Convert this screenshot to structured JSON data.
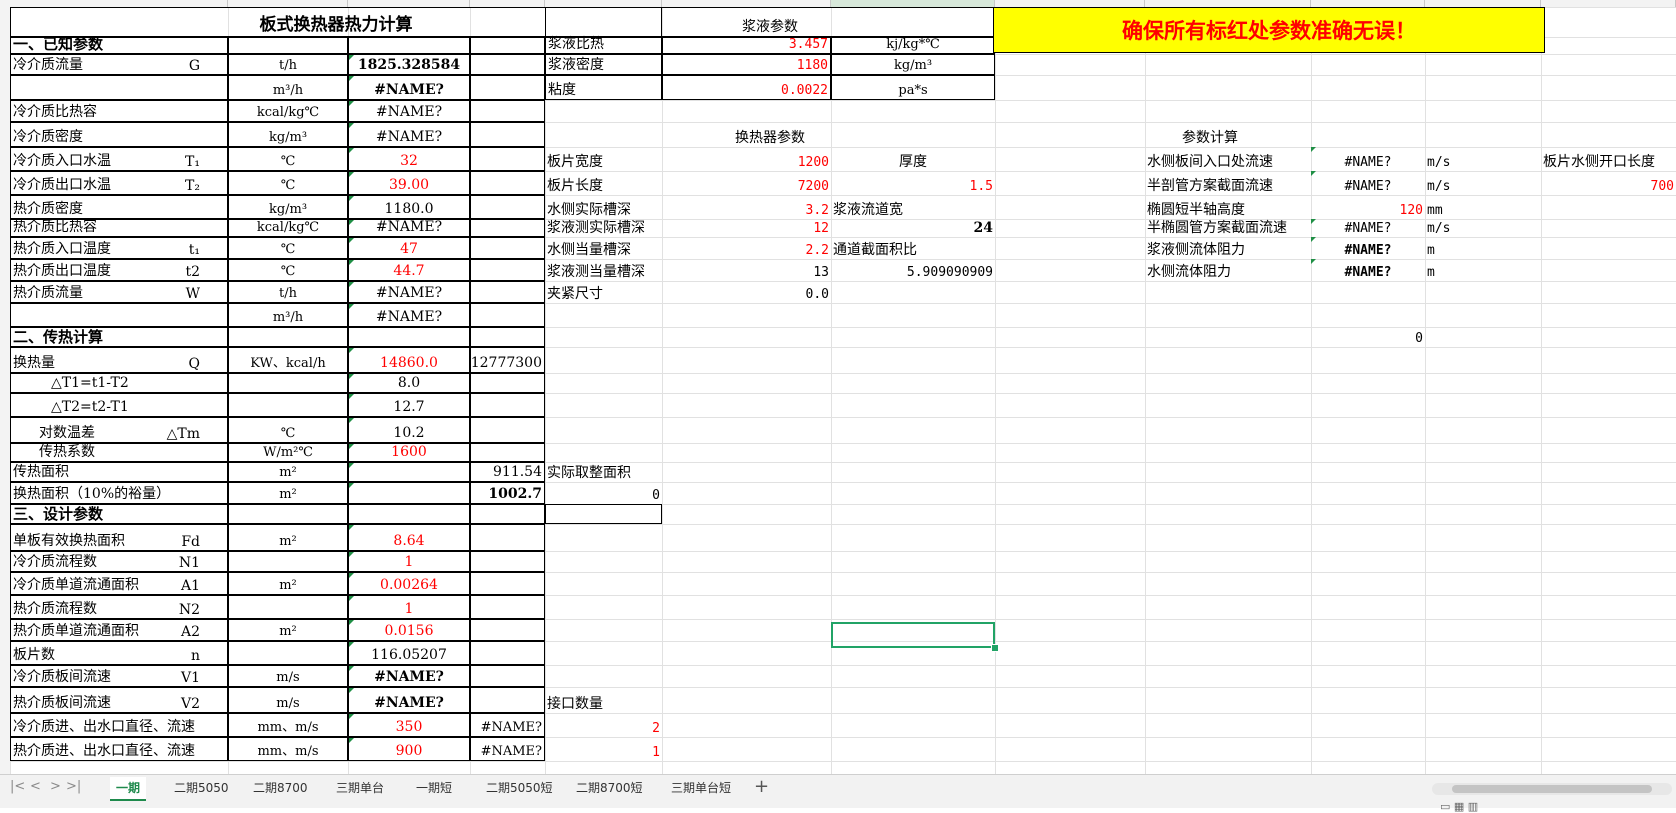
{
  "banner": "确保所有标红处参数准确无误！",
  "title": "板式换热器热力计算",
  "sec1": "一、已知参数",
  "sec2": "二、传热计算",
  "sec3": "三、设计参数",
  "rows": [
    {
      "name": "冷介质流量",
      "sym": "G",
      "unit": "t/h",
      "val": "1825.328584"
    },
    {
      "name": "",
      "sym": "",
      "unit": "m³/h",
      "val": "#NAME?"
    },
    {
      "name": "冷介质比热容",
      "sym": "",
      "unit": "kcal/kg℃",
      "val": "#NAME?"
    },
    {
      "name": "冷介质密度",
      "sym": "",
      "unit": "kg/m³",
      "val": "#NAME?"
    },
    {
      "name": "冷介质入口水温",
      "sym": "T₁",
      "unit": "℃",
      "val": "32"
    },
    {
      "name": "冷介质出口水温",
      "sym": "T₂",
      "unit": "℃",
      "val": "39.00"
    },
    {
      "name": "热介质密度",
      "sym": "",
      "unit": "kg/m³",
      "val": "1180.0"
    },
    {
      "name": "热介质比热容",
      "sym": "",
      "unit": "kcal/kg℃",
      "val": "#NAME?"
    },
    {
      "name": "热介质入口温度",
      "sym": "t₁",
      "unit": "℃",
      "val": "47"
    },
    {
      "name": "热介质出口温度",
      "sym": "t2",
      "unit": "℃",
      "val": "44.7"
    },
    {
      "name": "热介质流量",
      "sym": "W",
      "unit": "t/h",
      "val": "#NAME?"
    },
    {
      "name": "",
      "sym": "",
      "unit": "m³/h",
      "val": "#NAME?"
    },
    {
      "name": "换热量",
      "sym": "Q",
      "unit": "KW、kcal/h",
      "val": "14860.0",
      "extra": "12777300"
    },
    {
      "name": "△T1=t1-T2",
      "sym": "",
      "unit": "",
      "val": "8.0"
    },
    {
      "name": "△T2=t2-T1",
      "sym": "",
      "unit": "",
      "val": "12.7"
    },
    {
      "name": "对数温差",
      "sym": "△Tm",
      "unit": "℃",
      "val": "10.2"
    },
    {
      "name": "传热系数",
      "sym": "",
      "unit": "W/m²℃",
      "val": "1600"
    },
    {
      "name": "传热面积",
      "sym": "",
      "unit": "m²",
      "val": "",
      "extra": "911.54"
    },
    {
      "name": "换热面积（10%的裕量）",
      "sym": "",
      "unit": "m²",
      "val": "",
      "extra": "1002.7"
    },
    {
      "name": "单板有效换热面积",
      "sym": "Fd",
      "unit": "m²",
      "val": "8.64"
    },
    {
      "name": "冷介质流程数",
      "sym": "N1",
      "unit": "",
      "val": "1"
    },
    {
      "name": "冷介质单道流通面积",
      "sym": "A1",
      "unit": "m²",
      "val": "0.00264"
    },
    {
      "name": "热介质流程数",
      "sym": "N2",
      "unit": "",
      "val": "1"
    },
    {
      "name": "热介质单道流通面积",
      "sym": "A2",
      "unit": "m²",
      "val": "0.0156"
    },
    {
      "name": "板片数",
      "sym": "n",
      "unit": "",
      "val": "116.05207"
    },
    {
      "name": "冷介质板间流速",
      "sym": "V1",
      "unit": "m/s",
      "val": "#NAME?"
    },
    {
      "name": "热介质板间流速",
      "sym": "V2",
      "unit": "m/s",
      "val": "#NAME?"
    },
    {
      "name": "冷介质进、出水口直径、流速",
      "sym": "",
      "unit": "mm、m/s",
      "val": "350",
      "extra": "#NAME?"
    },
    {
      "name": "热介质进、出水口直径、流速",
      "sym": "",
      "unit": "mm、m/s",
      "val": "900",
      "extra": "#NAME?"
    }
  ],
  "slurry": {
    "title": "浆液参数",
    "items": [
      {
        "name": "浆液比热",
        "val": "3.457",
        "unit": "kj/kg*℃"
      },
      {
        "name": "浆液密度",
        "val": "1180",
        "unit": "kg/m³"
      },
      {
        "name": "粘度",
        "val": "0.0022",
        "unit": "pa*s"
      }
    ]
  },
  "hx": {
    "title": "换热器参数",
    "plate_width_label": "板片宽度",
    "plate_width": "1200",
    "thickness_label": "厚度",
    "thickness": "1.5",
    "plate_length_label": "板片长度",
    "plate_length": "7200",
    "water_depth_label": "水侧实际槽深",
    "water_depth": "3.2",
    "flow_width_label": "浆液流道宽",
    "slurry_depth_label": "浆液测实际槽深",
    "slurry_depth": "12",
    "flow_width": "24",
    "water_eq_label": "水侧当量槽深",
    "water_eq": "2.2",
    "area_ratio_label": "通道截面积比",
    "slurry_eq_label": "浆液测当量槽深",
    "slurry_eq": "13",
    "area_ratio": "5.909090909",
    "clamp_label": "夹紧尺寸",
    "clamp": "0.0",
    "actual_area_label": "实际取整面积",
    "actual_area": "0",
    "port_count_label": "接口数量",
    "port1": "2",
    "port2": "1"
  },
  "calc": {
    "title": "参数计算",
    "items": [
      {
        "name": "水侧板间入口处流速",
        "val": "#NAME?",
        "unit": "m/s"
      },
      {
        "name": "半剖管方案截面流速",
        "val": "#NAME?",
        "unit": "m/s"
      },
      {
        "name": "椭圆短半轴高度",
        "val": "120",
        "unit": "mm"
      },
      {
        "name": "半椭圆管方案截面流速",
        "val": "#NAME?",
        "unit": "m/s"
      },
      {
        "name": "浆液侧流体阻力",
        "val": "#NAME?",
        "unit": "m"
      },
      {
        "name": "水侧流体阻力",
        "val": "#NAME?",
        "unit": "m"
      }
    ],
    "extra_label": "板片水侧开口长度",
    "extra_val": "700",
    "zero": "0"
  },
  "tabs": [
    "一期",
    "二期5050",
    "二期8700",
    "三期单台",
    "一期短",
    "二期5050短",
    "二期8700短",
    "三期单台短"
  ],
  "active_tab": 0,
  "nav": {
    "first": "|<",
    "prev": "<",
    "next": ">",
    "last": ">|",
    "add": "+"
  }
}
